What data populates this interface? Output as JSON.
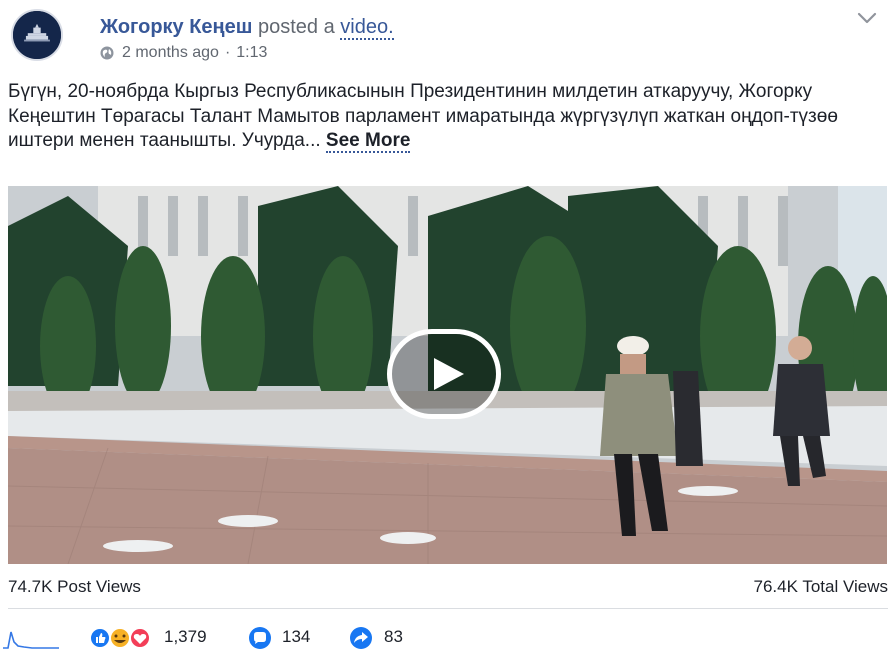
{
  "post": {
    "page_name": "Жогорку Кеңеш",
    "action_text": "posted a",
    "action_link": "video.",
    "time_ago": "2 months ago",
    "separator": "·",
    "duration": "1:13",
    "privacy_icon": "globe-icon",
    "menu_icon": "chevron-down-icon",
    "body_text": "Бүгүн, 20-ноябрда Кыргыз Республикасынын Президентинин милдетин аткаруучу, Жогорку Кеңештин Төрагасы Талант Мамытов парламент имаратында жүргүзүлүп жаткан оңдоп-түзөө иштери менен таанышты. Учурда...",
    "see_more": "See More"
  },
  "video": {
    "play_icon": "play-icon"
  },
  "stats": {
    "post_views": "74.7K Post Views",
    "total_views": "76.4K Total Views",
    "reactions_count": "1,379",
    "comments_count": "134",
    "shares_count": "83"
  },
  "colors": {
    "link": "#385898",
    "secondary_text": "#616770",
    "primary_text": "#1d2129",
    "like_blue": "#1877f2",
    "haha_yellow": "#f7b125",
    "love_red": "#f33e58"
  }
}
